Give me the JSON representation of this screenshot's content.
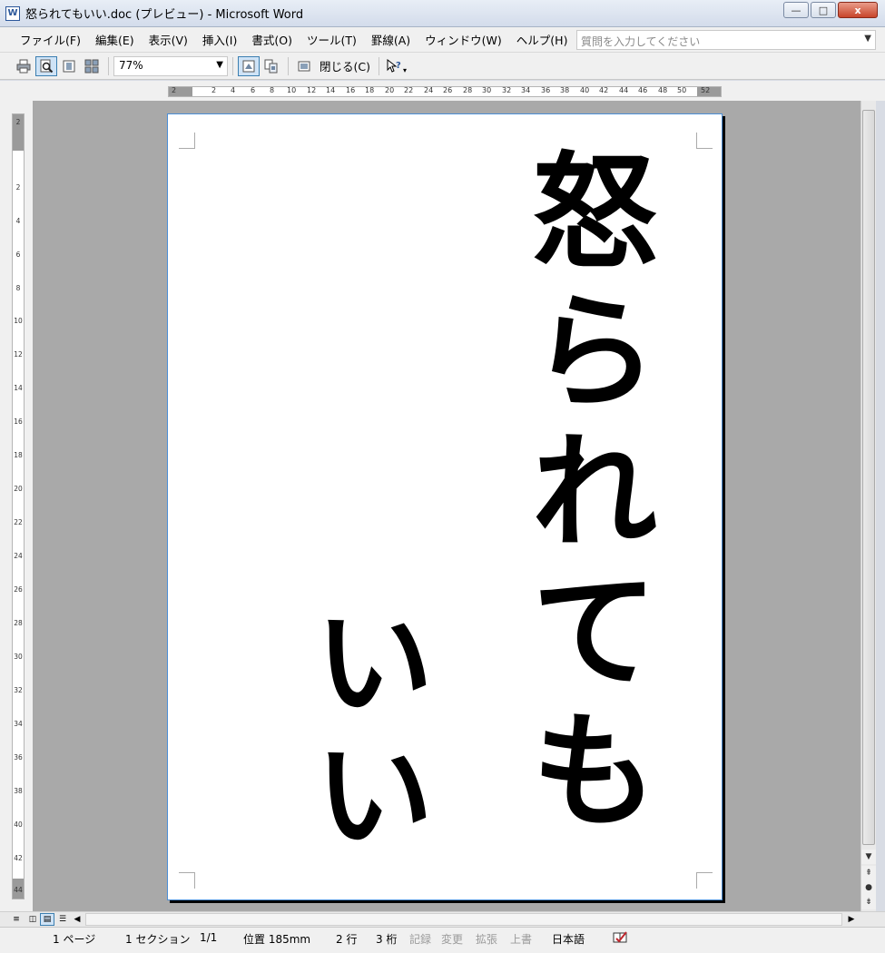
{
  "window": {
    "title": "怒られてもいい.doc (プレビュー) - Microsoft Word",
    "doc_icon": "W",
    "buttons": {
      "minimize": "—",
      "maximize": "□",
      "close": "x"
    }
  },
  "menubar": {
    "items": [
      "ファイル(F)",
      "編集(E)",
      "表示(V)",
      "挿入(I)",
      "書式(O)",
      "ツール(T)",
      "罫線(A)",
      "ウィンドウ(W)",
      "ヘルプ(H)"
    ],
    "help_placeholder": "質問を入力してください"
  },
  "toolbar": {
    "zoom_value": "77%",
    "close_label": "閉じる(C)"
  },
  "ruler_top": {
    "labels": [
      "2",
      "2",
      "4",
      "6",
      "8",
      "10",
      "12",
      "14",
      "16",
      "18",
      "20",
      "22",
      "24",
      "26",
      "28",
      "30",
      "32",
      "34",
      "36",
      "38",
      "40",
      "42",
      "44",
      "46",
      "48",
      "50",
      "52"
    ]
  },
  "ruler_left": {
    "labels": [
      "2",
      "2",
      "4",
      "6",
      "8",
      "10",
      "12",
      "14",
      "16",
      "18",
      "20",
      "22",
      "24",
      "26",
      "28",
      "30",
      "32",
      "34",
      "36",
      "38",
      "40",
      "42",
      "44"
    ]
  },
  "document": {
    "column_right": [
      "怒",
      "ら",
      "れ",
      "て",
      "も"
    ],
    "column_left": [
      "い",
      "い"
    ]
  },
  "statusbar": {
    "page": "1 ページ",
    "section": "1 セクション",
    "page_of": "1/1",
    "position": "位置  185mm",
    "line": "2 行",
    "column": "3 桁",
    "rec": "記録",
    "trk": "変更",
    "ext": "拡張",
    "ovr": "上書",
    "language": "日本語"
  }
}
